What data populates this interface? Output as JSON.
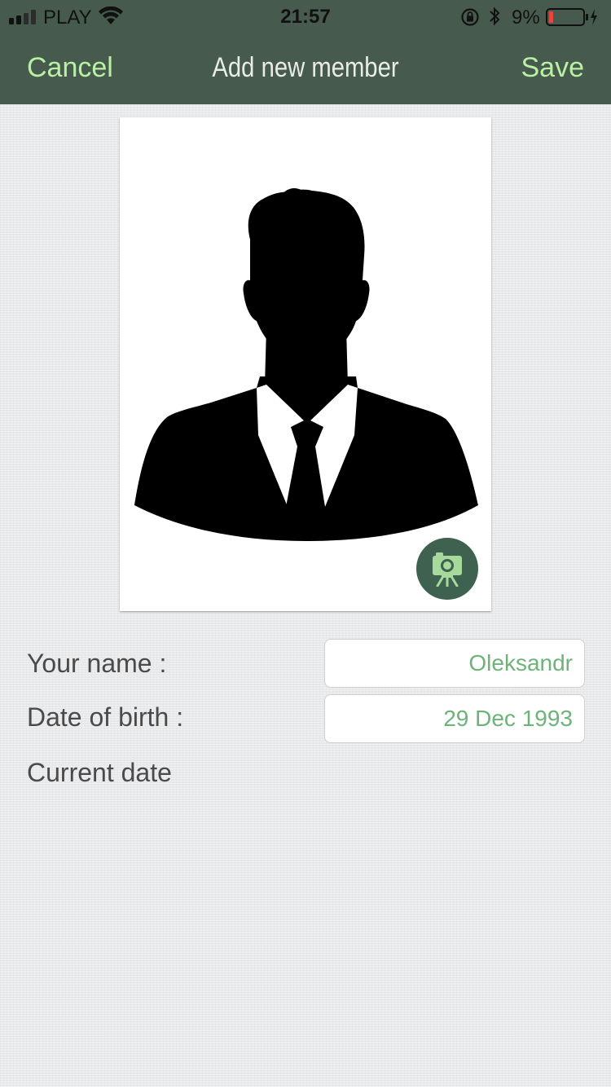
{
  "status_bar": {
    "carrier": "PLAY",
    "time": "21:57",
    "battery_percent": "9%"
  },
  "nav": {
    "cancel_label": "Cancel",
    "title": "Add new member",
    "save_label": "Save"
  },
  "photo": {
    "placeholder_icon": "person-silhouette-icon",
    "camera_icon": "camera-icon"
  },
  "form": {
    "name_label": "Your name :",
    "name_value": "Oleksandr",
    "dob_label": "Date of birth :",
    "dob_value": "29 Dec 1993",
    "current_date_label": "Current date"
  },
  "colors": {
    "nav_background": "#465a4e",
    "nav_button": "#b9f0a4",
    "field_text": "#6db37a",
    "camera_button": "#3f6150"
  }
}
